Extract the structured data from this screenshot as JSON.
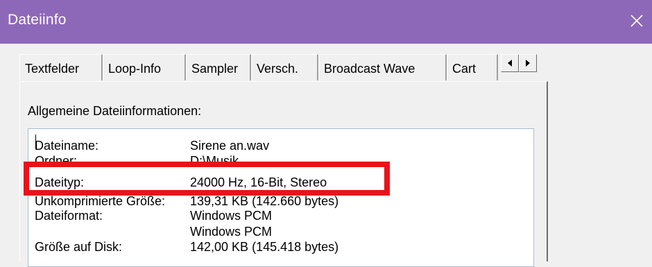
{
  "window": {
    "title": "Dateiinfo"
  },
  "tabs": [
    {
      "label": "Textfelder"
    },
    {
      "label": "Loop-Info"
    },
    {
      "label": "Sampler"
    },
    {
      "label": "Versch."
    },
    {
      "label": "Broadcast Wave"
    },
    {
      "label": "Cart"
    }
  ],
  "section": {
    "label": "Allgemeine Dateiinformationen:"
  },
  "fileinfo": {
    "rows": [
      {
        "key": "Dateiname:",
        "value": "Sirene an.wav"
      },
      {
        "key": "Ordner:",
        "value": "D:\\Musik"
      },
      {
        "key": "Dateityp:",
        "value": "24000 Hz, 16-Bit, Stereo"
      },
      {
        "key": "Unkomprimierte Größe:",
        "value": "139,31 KB (142.660 bytes)"
      },
      {
        "key": "Dateiformat:",
        "value": "Windows PCM"
      },
      {
        "key": "",
        "value": "Windows PCM"
      },
      {
        "key": "Größe auf Disk:",
        "value": "142,00 KB (145.418 bytes)"
      }
    ]
  },
  "colors": {
    "titlebar": "#8e68b8",
    "highlight": "#e8131a",
    "window_bg": "#f0f0f0"
  }
}
